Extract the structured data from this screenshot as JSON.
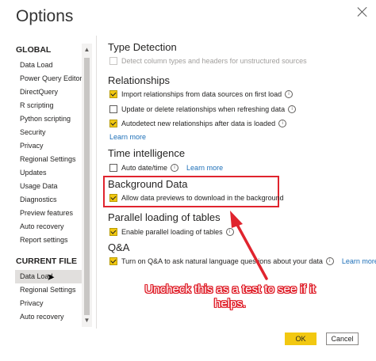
{
  "dialog": {
    "title": "Options"
  },
  "sidebar": {
    "global_heading": "GLOBAL",
    "global_items": [
      "Data Load",
      "Power Query Editor",
      "DirectQuery",
      "R scripting",
      "Python scripting",
      "Security",
      "Privacy",
      "Regional Settings",
      "Updates",
      "Usage Data",
      "Diagnostics",
      "Preview features",
      "Auto recovery",
      "Report settings"
    ],
    "current_heading": "CURRENT FILE",
    "current_items": [
      "Data Load",
      "Regional Settings",
      "Privacy",
      "Auto recovery"
    ],
    "selected": "Data Load (current file)"
  },
  "sections": {
    "type_detection": {
      "heading": "Type Detection",
      "detect_types": {
        "label": "Detect column types and headers for unstructured sources",
        "checked": false,
        "disabled": true
      }
    },
    "relationships": {
      "heading": "Relationships",
      "import_rel": {
        "label": "Import relationships from data sources on first load",
        "checked": true
      },
      "update_rel": {
        "label": "Update or delete relationships when refreshing data",
        "checked": false
      },
      "autodetect": {
        "label": "Autodetect new relationships after data is loaded",
        "checked": true
      },
      "learn_more": "Learn more"
    },
    "time_intelligence": {
      "heading": "Time intelligence",
      "auto_date": {
        "label": "Auto date/time",
        "checked": false
      },
      "learn_more": "Learn more"
    },
    "background_data": {
      "heading": "Background Data",
      "previews": {
        "label": "Allow data previews to download in the background",
        "checked": true
      }
    },
    "parallel": {
      "heading": "Parallel loading of tables",
      "enable": {
        "label": "Enable parallel loading of tables",
        "checked": true
      }
    },
    "qa": {
      "heading": "Q&A",
      "turn_on": {
        "label": "Turn on Q&A to ask natural language questions about your data",
        "checked": true
      },
      "learn_more": "Learn more"
    }
  },
  "annotation": {
    "text": "Uncheck this as a test to see if it helps.",
    "color": "#e0242e"
  },
  "buttons": {
    "ok": "OK",
    "cancel": "Cancel"
  },
  "colors": {
    "accent": "#f2c811",
    "link": "#1d6fb8",
    "highlight": "#e0242e"
  }
}
